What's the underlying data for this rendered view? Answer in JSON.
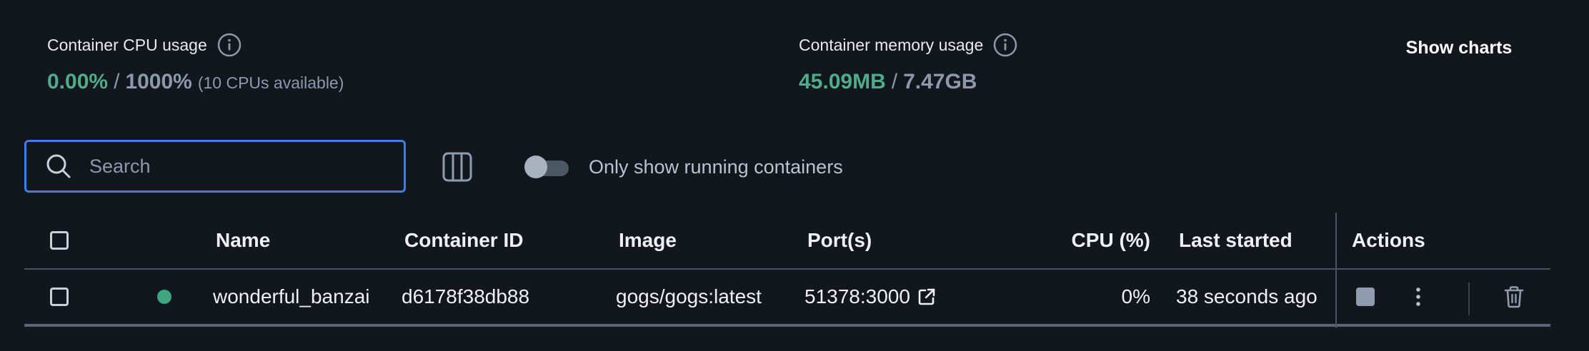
{
  "stats": {
    "cpu": {
      "label": "Container CPU usage",
      "used": "0.00%",
      "separator": "/",
      "total": "1000%",
      "note": "(10 CPUs available)"
    },
    "memory": {
      "label": "Container memory usage",
      "used": "45.09MB",
      "separator": "/",
      "total": "7.47GB"
    },
    "show_charts_label": "Show charts"
  },
  "toolbar": {
    "search_placeholder": "Search",
    "search_value": "",
    "running_only_label": "Only show running containers",
    "running_only_enabled": false
  },
  "table": {
    "columns": {
      "name": "Name",
      "container_id": "Container ID",
      "image": "Image",
      "ports": "Port(s)",
      "cpu": "CPU (%)",
      "last_started": "Last started",
      "actions": "Actions"
    },
    "rows": [
      {
        "status": "running",
        "name": "wonderful_banzai",
        "container_id": "d6178f38db88",
        "image": "gogs/gogs:latest",
        "ports": "51378:3000",
        "cpu": "0%",
        "last_started": "38 seconds ago"
      }
    ]
  },
  "colors": {
    "background": "#12161d",
    "accent_blue": "#3d7fe3",
    "used_green": "#4fab8a",
    "muted": "#8d99aa",
    "status_running": "#3fa57e"
  },
  "icons": {
    "cpu_info": "info-circle-icon",
    "memory_info": "info-circle-icon",
    "search": "magnifier-icon",
    "columns": "columns-icon",
    "port_link": "external-link-icon",
    "stop": "stop-square-icon",
    "more": "vertical-dots-icon",
    "delete": "trash-icon"
  }
}
